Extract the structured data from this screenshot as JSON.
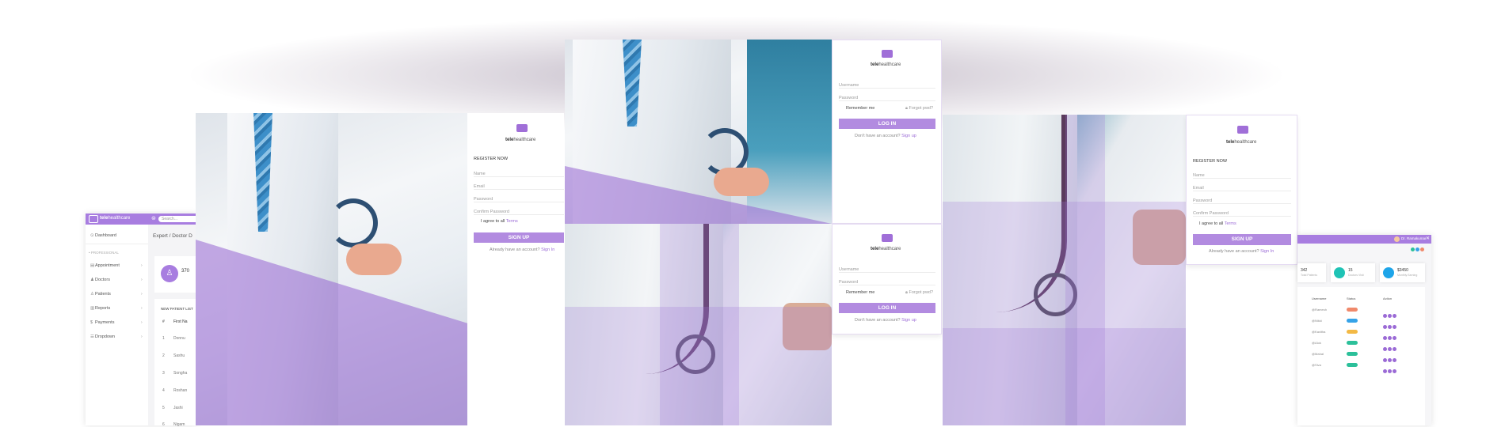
{
  "brand": {
    "name_bold": "tele",
    "name_rest": "healthcare"
  },
  "dashboard_left": {
    "search_placeholder": "Search...",
    "menu_dashboard": "Dashboard",
    "section_label": "PROFESSIONAL",
    "nav_items": [
      "Appointment",
      "Doctors",
      "Patients",
      "Reports",
      "Payments",
      "Dropdown"
    ],
    "breadcrumb": "Expert / Doctor D",
    "stat_value": "370",
    "list_title": "NEW PATIENT LIST",
    "table_headers": [
      "#",
      "First Na"
    ],
    "rows": [
      {
        "num": "1",
        "name": "Donnu"
      },
      {
        "num": "2",
        "name": "Sashu"
      },
      {
        "num": "3",
        "name": "Songha"
      },
      {
        "num": "4",
        "name": "Roshan"
      },
      {
        "num": "5",
        "name": "Jashi"
      },
      {
        "num": "6",
        "name": "Nigam"
      }
    ]
  },
  "register_form_left": {
    "heading": "REGISTER NOW",
    "fields": [
      "Name",
      "Email",
      "Password",
      "Confirm Password"
    ],
    "agree_text": "I agree to all",
    "terms_link": "Terms",
    "submit": "SIGN UP",
    "footer_text": "Already have an account?",
    "footer_link": "Sign In"
  },
  "login_form_top": {
    "fields": [
      "Username",
      "Password"
    ],
    "remember": "Remember me",
    "forgot": "Forgot pwd?",
    "submit": "LOG IN",
    "footer_text": "Don't have an account?",
    "footer_link": "Sign up"
  },
  "login_form_bottom": {
    "fields": [
      "Username",
      "Password"
    ],
    "remember": "Remember me",
    "forgot": "Forgot pwd?",
    "submit": "LOG IN",
    "footer_text": "Don't have an account?",
    "footer_link": "Sign up"
  },
  "register_form_right": {
    "heading": "REGISTER NOW",
    "fields": [
      "Name",
      "Email",
      "Password",
      "Confirm Password"
    ],
    "agree_text": "I agree to all",
    "terms_link": "Terms",
    "submit": "SIGN UP",
    "footer_text": "Already have an account?",
    "footer_link": "Sign In"
  },
  "dashboard_right": {
    "user_name": "Dr. Ramakumar",
    "stats": [
      {
        "value": "342",
        "label": "Total Patients",
        "color": "#ffffff"
      },
      {
        "value": "15",
        "label": "Doctors Visit",
        "color": "#1fc3b5"
      },
      {
        "value": "$3450",
        "label": "Monthly Earning",
        "color": "#1ea5e9"
      }
    ],
    "table_headers": [
      "Username",
      "Status",
      "Action"
    ],
    "rows": [
      {
        "user": "@Ramesh",
        "status_color": "#f0896b"
      },
      {
        "user": "@Nikki",
        "status_color": "#36a3e8"
      },
      {
        "user": "@Kavitha",
        "status_color": "#f3b945"
      },
      {
        "user": "@Alok",
        "status_color": "#2cc09a"
      },
      {
        "user": "@Mahal",
        "status_color": "#2cc09a"
      },
      {
        "user": "@Siva",
        "status_color": "#2cc09a"
      }
    ]
  },
  "colors": {
    "accent": "#a87de0",
    "button": "#b28be0",
    "link": "#9b6bd6"
  }
}
